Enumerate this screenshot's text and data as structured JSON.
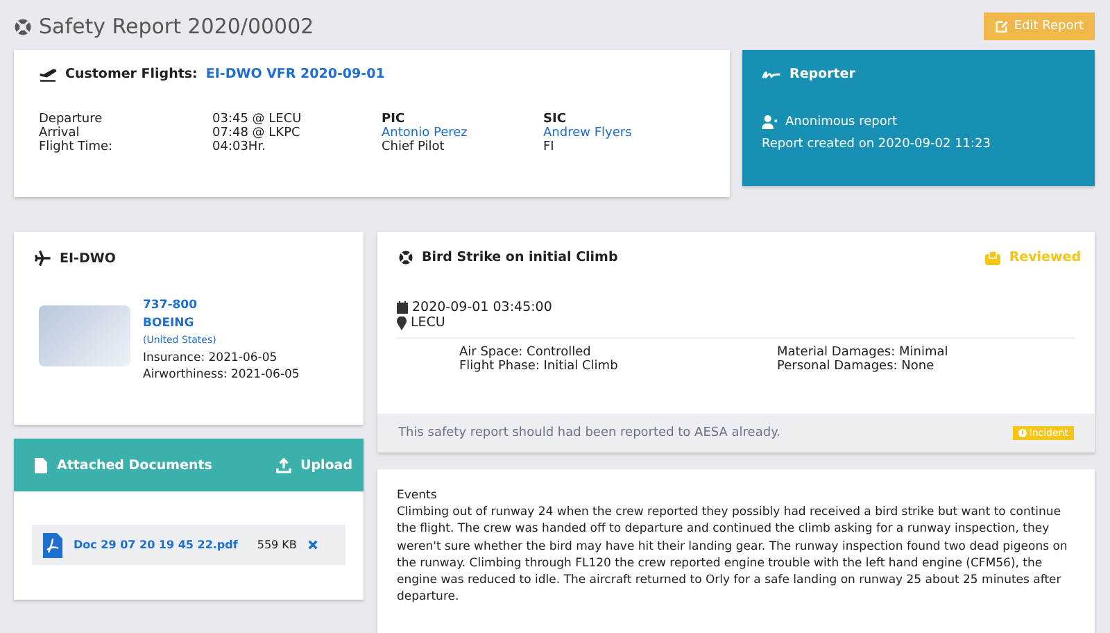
{
  "page": {
    "title": "Safety Report 2020/00002",
    "edit_button": "Edit Report"
  },
  "flight": {
    "label": "Customer Flights:",
    "link": "EI-DWO VFR 2020-09-01",
    "times": [
      {
        "label": "Departure",
        "value": "03:45 @ LECU"
      },
      {
        "label": "Arrival",
        "value": "07:48 @ LKPC"
      },
      {
        "label": "Flight Time:",
        "value": "04:03Hr."
      }
    ],
    "crew": [
      {
        "role": "PIC",
        "name": "Antonio Perez",
        "title": "Chief Pilot"
      },
      {
        "role": "SIC",
        "name": "Andrew Flyers",
        "title": "FI"
      }
    ]
  },
  "reporter": {
    "title": "Reporter",
    "anonymous": "Anonimous report",
    "created": "Report created on 2020-09-02 11:23"
  },
  "aircraft": {
    "title": "EI-DWO",
    "model": "737-800",
    "maker": "BOEING",
    "country": "(United States)",
    "insurance": "Insurance: 2021-06-05",
    "airworthiness": "Airworthiness: 2021-06-05"
  },
  "documents": {
    "title": "Attached Documents",
    "upload": "Upload",
    "files": [
      {
        "name": "Doc 29 07 20 19 45 22.pdf",
        "size": "559 KB"
      }
    ]
  },
  "event": {
    "title": "Bird Strike on initial Climb",
    "status": "Reviewed",
    "date": "2020-09-01 03:45:00",
    "place": "LECU",
    "details_left": [
      "Air Space: Controlled",
      "Flight Phase: Initial Climb"
    ],
    "details_right": [
      "Material Damages: Minimal",
      "Personal Damages: None"
    ],
    "note": "This safety report should had been reported to AESA already.",
    "badge": "Incident"
  },
  "events_section": {
    "heading": "Events",
    "text": "Climbing out of runway 24 when the crew reported they possibly had received a bird strike but want to continue the flight. The crew was handed off to departure and continued the climb asking for a runway inspection, they weren't sure whether the bird may have hit their landing gear. The runway inspection found two dead pigeons on the runway. Climbing through FL120 the crew reported engine trouble with the left hand engine (CFM56), the engine was reduced to idle. The aircraft returned to Orly for a safe landing on runway 25 about 25 minutes after departure."
  }
}
